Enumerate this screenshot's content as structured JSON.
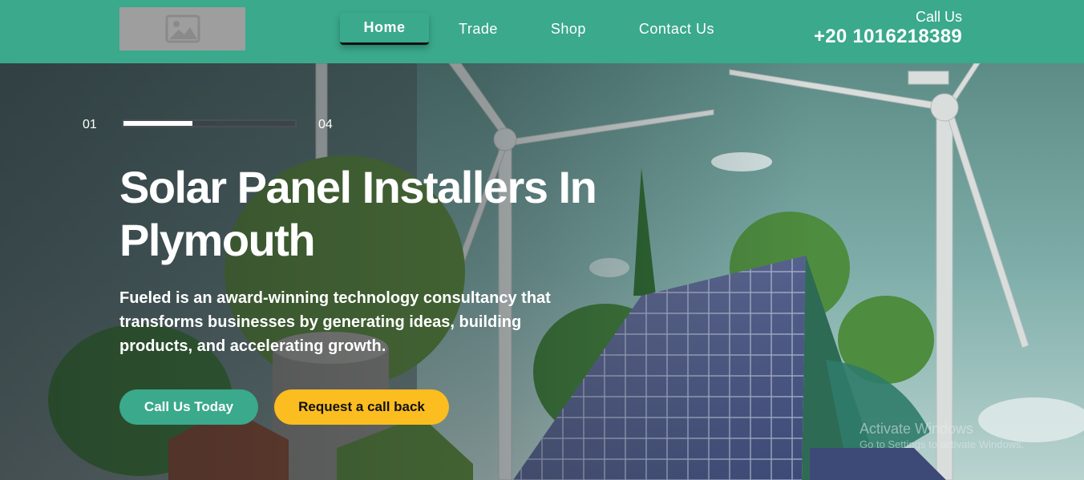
{
  "header": {
    "logo": {
      "icon": "image-placeholder-icon"
    },
    "nav": [
      {
        "label": "Home",
        "active": true
      },
      {
        "label": "Trade",
        "active": false
      },
      {
        "label": "Shop",
        "active": false
      },
      {
        "label": "Contact Us",
        "active": false
      }
    ],
    "call_label": "Call Us",
    "call_number": "+20 1016218389"
  },
  "hero": {
    "slider": {
      "current": "01",
      "total": "04",
      "progress": 0.4
    },
    "title": "Solar Panel Installers In Plymouth",
    "description": "Fueled is an award-winning technology consultancy that transforms businesses by generating ideas, building products, and accelerating growth.",
    "primary_button": "Call Us Today",
    "secondary_button": "Request a call back"
  },
  "watermark": {
    "title": "Activate Windows",
    "subtitle": "Go to Settings to activate Windows."
  },
  "colors": {
    "brand": "#3aa98c",
    "accent": "#fbbd1f",
    "text_light": "#ffffff"
  }
}
